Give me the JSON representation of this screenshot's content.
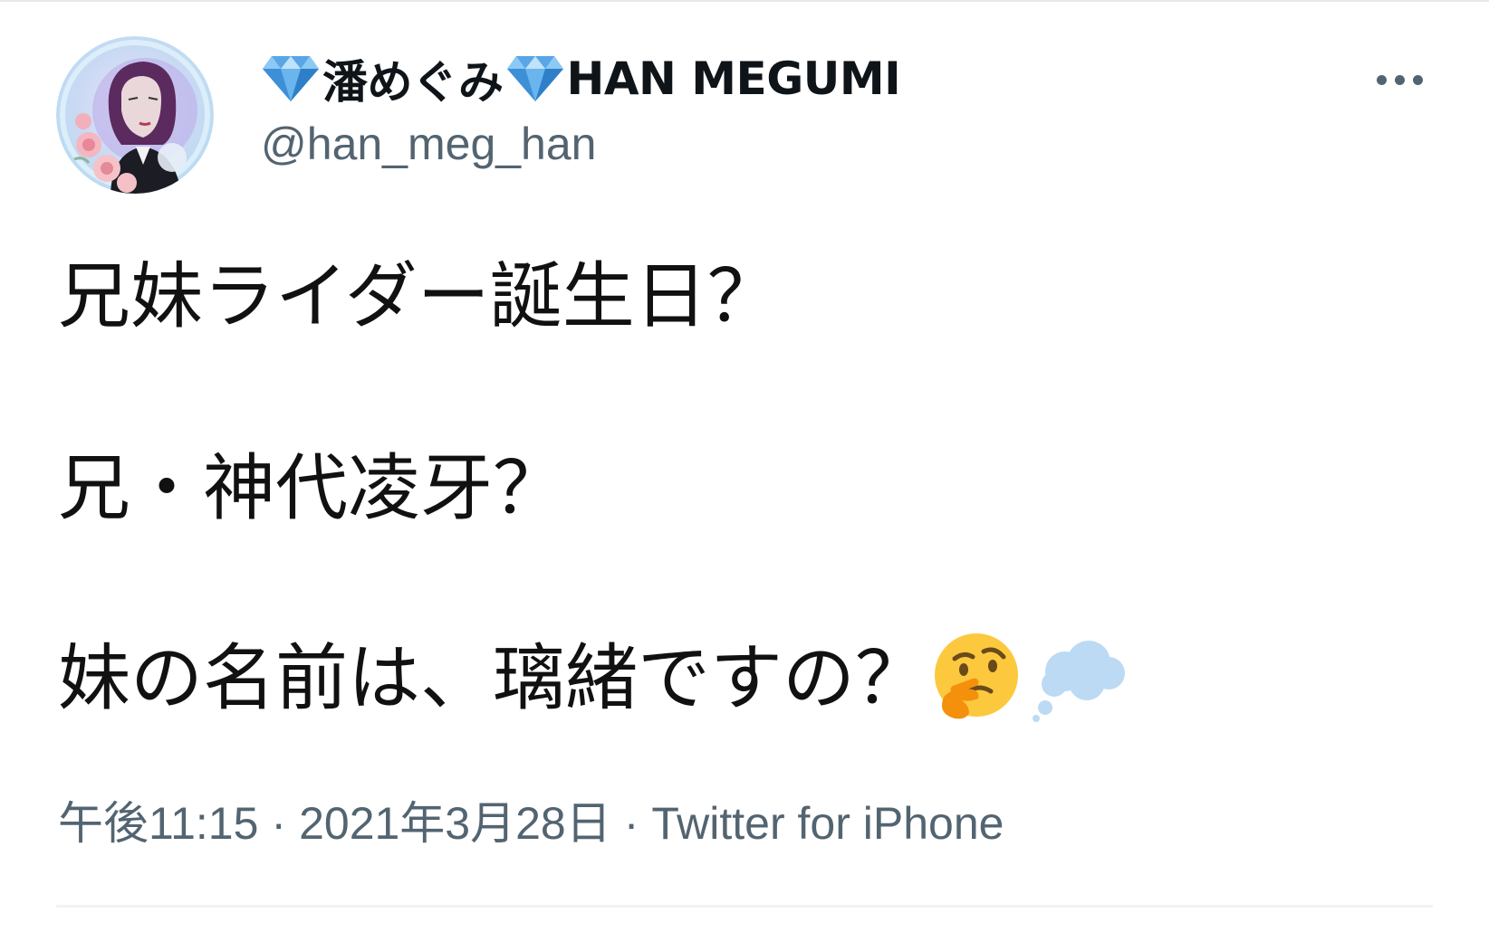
{
  "tweet": {
    "author": {
      "display_name_text_1": "潘めぐみ",
      "display_name_text_2": "HAN MEGUMI",
      "handle": "@han_meg_han",
      "name_icon": "gem-stone-icon",
      "avatar_icon": "avatar-illustration"
    },
    "more_icon": "more-dots-icon",
    "body": {
      "line1": "兄妹ライダー誕生日？",
      "line2": "兄・神代凌牙？",
      "line3": "妹の名前は、璃緒ですの？",
      "line3_emojis": [
        "thinking-face-icon",
        "thought-balloon-icon"
      ]
    },
    "meta": {
      "time": "午後11:15",
      "separator": "·",
      "date": "2021年3月28日",
      "source": "Twitter for iPhone"
    },
    "colors": {
      "text": "#0f1419",
      "secondary_text": "#536471",
      "divider": "#eff3f4",
      "gem": "#5aa5e6",
      "avatar_ring": "#cfe6f7"
    }
  }
}
